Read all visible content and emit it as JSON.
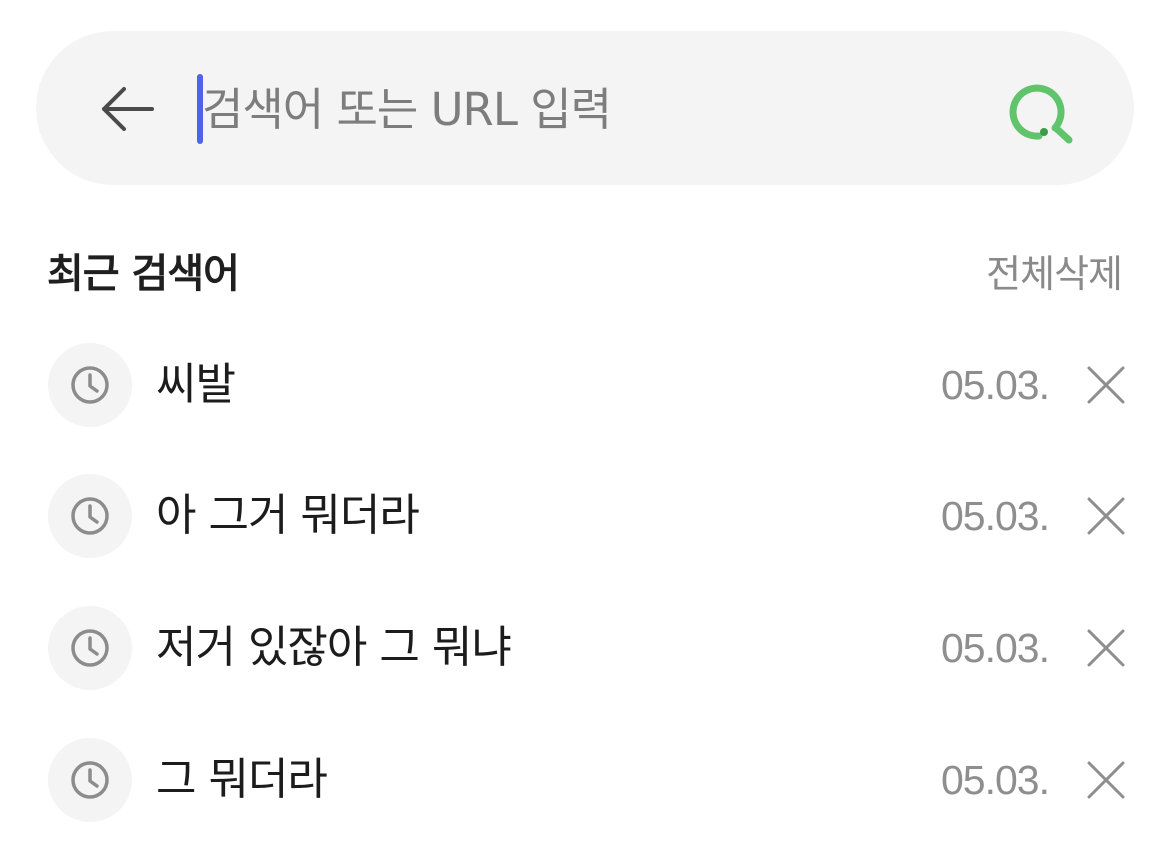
{
  "search": {
    "placeholder": "검색어 또는 URL 입력",
    "value": ""
  },
  "icons": {
    "back": "arrow-left-icon",
    "search": "search-icon",
    "history": "clock-icon",
    "delete": "close-icon"
  },
  "colors": {
    "accent_green": "#5fc46b",
    "caret_blue": "#4f63e8",
    "muted_text": "#8a8a8a"
  },
  "recent": {
    "title": "최근 검색어",
    "clear_all_label": "전체삭제",
    "items": [
      {
        "text": "씨발",
        "date": "05.03."
      },
      {
        "text": "아 그거 뭐더라",
        "date": "05.03."
      },
      {
        "text": "저거 있잖아 그 뭐냐",
        "date": "05.03."
      },
      {
        "text": "그 뭐더라",
        "date": "05.03."
      }
    ]
  }
}
